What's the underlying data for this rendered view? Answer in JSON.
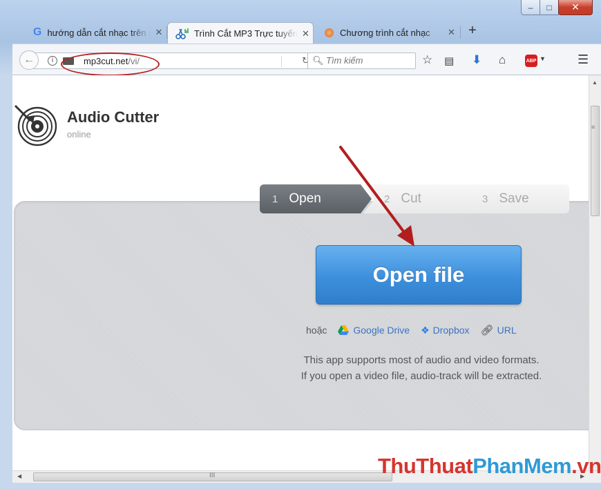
{
  "window": {
    "minimize": "–",
    "maximize": "□",
    "close": "✕"
  },
  "tabs": [
    {
      "title": "hướng dẫn cắt nhạc trên máy tính",
      "icon": "google-icon"
    },
    {
      "title": "Trình Cắt MP3 Trực tuyến",
      "icon": "scissors-icon",
      "active": true
    },
    {
      "title": "Chương trình cắt nhạc",
      "icon": "chuong-trinh-icon"
    }
  ],
  "tab_close": "✕",
  "new_tab": "+",
  "navbar": {
    "url_domain": "mp3cut.net",
    "url_path": "/vi/",
    "search_placeholder": "Tìm kiếm"
  },
  "app": {
    "title": "Audio Cutter",
    "subtitle": "online"
  },
  "steps": [
    {
      "num": "1",
      "label": "Open"
    },
    {
      "num": "2",
      "label": "Cut"
    },
    {
      "num": "3",
      "label": "Save"
    }
  ],
  "open_button": "Open file",
  "alt_sources": {
    "or": "hoặc",
    "google_drive": "Google Drive",
    "dropbox": "Dropbox",
    "url": "URL"
  },
  "support": {
    "line1": "This app supports most of audio and video formats.",
    "line2": "If you open a video file, audio-track will be extracted."
  },
  "scrollbar_grip": "III",
  "watermark": {
    "part1": "ThuThuat",
    "part2": "PhanMem",
    "part3": ".vn"
  },
  "colors": {
    "accent_blue": "#3d8fdc",
    "annotation_red": "#b62222",
    "watermark_red": "#d6352e",
    "watermark_blue": "#2f9ad6"
  }
}
